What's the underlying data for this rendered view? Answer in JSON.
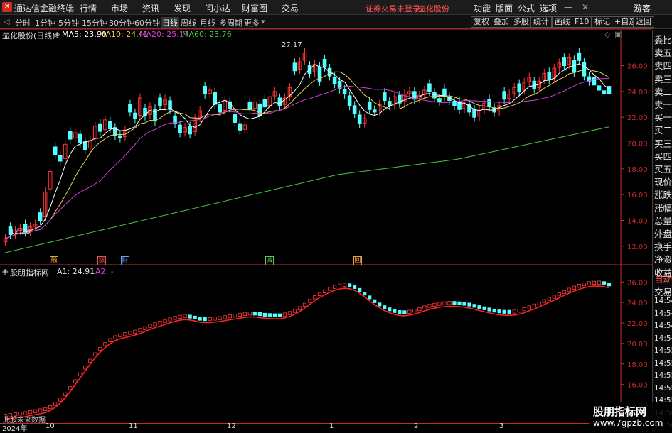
{
  "app": {
    "title": "通达信金融终端",
    "menu": [
      "行情",
      "市场",
      "资讯",
      "发现",
      "问小达",
      "财富圈",
      "交易"
    ],
    "notice": "证券交易未登录",
    "stock_title": "壶化股份",
    "right_menu": [
      "功能",
      "版面",
      "公式",
      "选项"
    ],
    "guest": "游客"
  },
  "toolbar": {
    "periods": [
      "分时",
      "1分钟",
      "5分钟",
      "15分钟",
      "30分钟",
      "60分钟",
      "日线",
      "周线",
      "月线",
      "多周期",
      "更多"
    ],
    "selected": "日线",
    "right_buttons": [
      "复权",
      "叠加",
      "多股",
      "统计",
      "画线",
      "F10",
      "标记",
      "+自选",
      "返回"
    ]
  },
  "main_chart": {
    "title": "壶化股份(日线)",
    "ma": [
      {
        "label": "MA5: 23.90",
        "color": "#ffffff"
      },
      {
        "label": "MA10: 24.41",
        "color": "#e6d35a"
      },
      {
        "label": "MA20: 25.17",
        "color": "#d23fd2"
      },
      {
        "label": "MA60: 23.76",
        "color": "#46c846"
      }
    ],
    "high_label": "27.17",
    "low_label": "12.28",
    "y_ticks": [
      "26.00",
      "24.00",
      "22.00",
      "20.00",
      "18.00",
      "16.00",
      "14.00",
      "12.00"
    ],
    "events": [
      {
        "text": "融",
        "color": "#e8a23c"
      },
      {
        "text": "涨",
        "color": "#e05050"
      },
      {
        "text": "财",
        "color": "#5fa0f0"
      },
      {
        "text": "减",
        "color": "#5cc85c"
      },
      {
        "text": "回",
        "color": "#e8a23c"
      }
    ]
  },
  "indicator": {
    "title": "股朋指标网",
    "a1": "A1: 24.91",
    "a2": "A2: -",
    "y_ticks": [
      "26.00",
      "24.00",
      "22.00",
      "20.00",
      "18.00",
      "16.00",
      "14.00"
    ],
    "no_data": "此股未来数据"
  },
  "side_panel": [
    "委比",
    "卖五",
    "卖四",
    "卖三",
    "卖二",
    "卖一",
    "买一",
    "买二",
    "买三",
    "买四",
    "买五",
    "现价",
    "涨跌",
    "涨幅",
    "总量",
    "外盘",
    "换手",
    "净资",
    "收益"
  ],
  "side_panel_lower": [
    "自动",
    "交易",
    "14:54",
    "14:54",
    "14:54",
    "14:54",
    "14:55",
    "14:55",
    "14:55",
    "14:55",
    "14:55",
    "14:56",
    "14:56"
  ],
  "dates": [
    "2024年",
    "10",
    "11",
    "12",
    "1",
    "2",
    "3"
  ],
  "watermark": {
    "title": "股朋指标网",
    "url": "www.7gpzb.com"
  },
  "colors": {
    "up": "#ff3232",
    "down": "#54ffff",
    "axis": "#cc2a2a",
    "ma5": "#ffffff",
    "ma10": "#e6d35a",
    "ma20": "#d23fd2",
    "ma60": "#46c846"
  },
  "chart_data": {
    "type": "candlestick",
    "price_range": [
      11,
      27.9
    ],
    "closes": [
      12.6,
      12.9,
      13.2,
      13.4,
      13.1,
      13.5,
      13.7,
      14.0,
      16.2,
      17.8,
      19.1,
      18.6,
      19.9,
      20.3,
      20.8,
      20.0,
      19.5,
      20.2,
      21.3,
      20.9,
      21.8,
      21.1,
      20.6,
      20.4,
      21.0,
      22.4,
      21.9,
      23.5,
      22.1,
      22.8,
      21.7,
      22.9,
      23.4,
      22.6,
      21.5,
      20.8,
      21.2,
      20.7,
      21.9,
      22.5,
      23.8,
      24.1,
      23.0,
      22.4,
      23.3,
      22.7,
      21.6,
      21.0,
      21.4,
      22.6,
      23.2,
      22.1,
      22.8,
      23.6,
      24.0,
      22.9,
      23.5,
      24.3,
      25.6,
      26.3,
      27.0,
      25.4,
      26.1,
      24.8,
      25.9,
      25.2,
      24.6,
      24.2,
      23.8,
      22.9,
      22.3,
      21.5,
      21.9,
      22.6,
      22.4,
      23.0,
      23.3,
      22.9,
      23.6,
      23.1,
      23.8,
      24.0,
      23.4,
      23.7,
      24.1,
      24.0,
      23.5,
      23.2,
      23.6,
      23.3,
      22.9,
      22.6,
      23.1,
      22.4,
      22.0,
      22.5,
      23.1,
      22.8,
      22.4,
      22.9,
      23.4,
      23.8,
      24.3,
      24.0,
      24.7,
      25.1,
      24.2,
      24.8,
      25.4,
      24.9,
      25.8,
      26.2,
      26.0,
      26.6,
      25.5,
      26.4,
      25.2,
      24.8,
      24.5,
      24.1,
      23.8,
      23.8
    ]
  }
}
